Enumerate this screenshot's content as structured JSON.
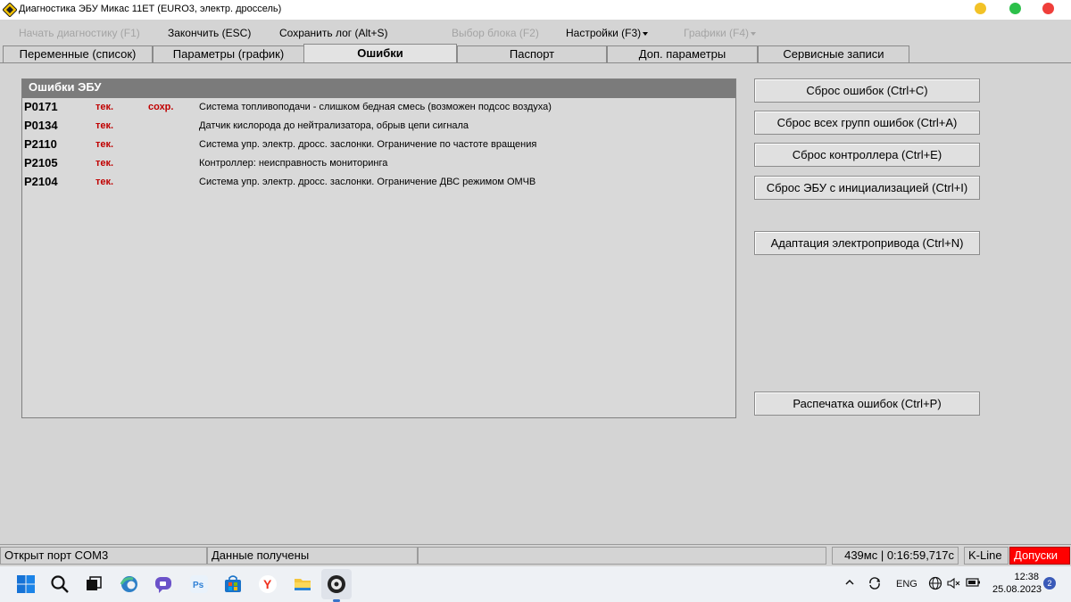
{
  "window": {
    "title": "Диагностика ЭБУ Микас 11ЕТ (EURO3, электр. дроссель)"
  },
  "menu": {
    "start": "Начать диагностику (F1)",
    "finish": "Закончить (ESC)",
    "save_log": "Сохранить лог (Alt+S)",
    "select_block": "Выбор блока (F2)",
    "settings": "Настройки (F3)",
    "charts": "Графики (F4)"
  },
  "tabs": [
    {
      "label": "Переменные (список)"
    },
    {
      "label": "Параметры (график)"
    },
    {
      "label": "Ошибки"
    },
    {
      "label": "Паспорт"
    },
    {
      "label": "Доп. параметры"
    },
    {
      "label": "Сервисные записи"
    }
  ],
  "errors": {
    "header": "Ошибки ЭБУ",
    "rows": [
      {
        "code": "P0171",
        "status": "тек.",
        "saved": "сохр.",
        "description": "Система топливоподачи - слишком бедная смесь (возможен подсос воздуха)"
      },
      {
        "code": "P0134",
        "status": "тек.",
        "saved": "",
        "description": "Датчик кислорода до нейтрализатора, обрыв цепи сигнала"
      },
      {
        "code": "P2110",
        "status": "тек.",
        "saved": "",
        "description": "Система упр. электр. дросс. заслонки. Ограничение по частоте вращения"
      },
      {
        "code": "P2105",
        "status": "тек.",
        "saved": "",
        "description": "Контроллер: неисправность мониторинга"
      },
      {
        "code": "P2104",
        "status": "тек.",
        "saved": "",
        "description": "Система упр. электр. дросс. заслонки. Ограничение ДВС режимом ОМЧВ"
      }
    ]
  },
  "actions": {
    "reset_errors": "Сброс ошибок (Ctrl+C)",
    "reset_all_groups": "Сброс всех групп ошибок (Ctrl+A)",
    "reset_controller": "Сброс контроллера (Ctrl+E)",
    "reset_ecu_init": "Сброс ЭБУ с инициализацией (Ctrl+I)",
    "adaptation": "Адаптация электропривода (Ctrl+N)",
    "print_errors": "Распечатка ошибок (Ctrl+P)"
  },
  "status": {
    "port": "Открыт порт COM3",
    "data": "Данные получены",
    "empty": "",
    "timing": "439мс | 0:16:59,717с",
    "protocol": "K-Line",
    "access": "Допуски",
    "access_color": "#ff0000"
  },
  "taskbar": {
    "icons": [
      "windows-start-icon",
      "search-icon",
      "task-view-icon",
      "edge-icon",
      "chat-icon",
      "photoshop-icon",
      "store-icon",
      "yandex-icon",
      "file-explorer-icon",
      "diagnostics-app-icon"
    ],
    "language": "ENG",
    "time": "12:38",
    "date": "25.08.2023",
    "notifications": "2"
  }
}
